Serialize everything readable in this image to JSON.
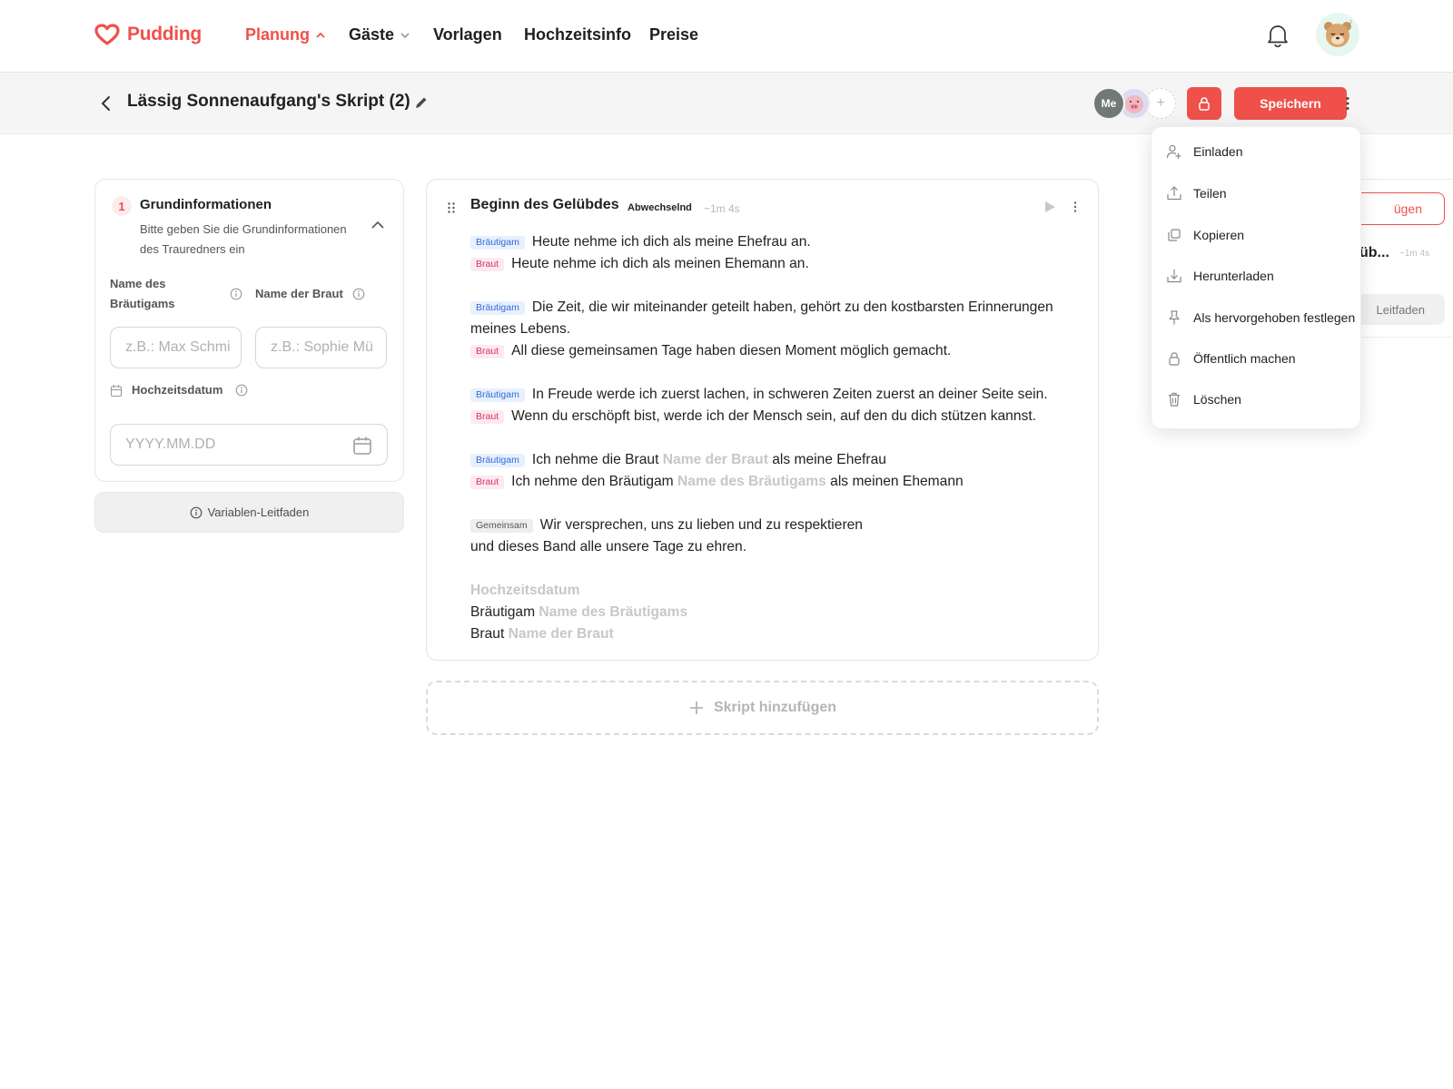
{
  "brand": {
    "name": "Pudding",
    "accent": "#f0504a"
  },
  "nav": {
    "items": [
      {
        "label": "Planung",
        "active": true,
        "chevron": "up"
      },
      {
        "label": "Gäste",
        "active": false,
        "chevron": "down"
      },
      {
        "label": "Vorlagen",
        "active": false
      },
      {
        "label": "Hochzeitsinfo",
        "active": false
      },
      {
        "label": "Preise",
        "active": false
      }
    ],
    "icons": [
      "bell-icon",
      "user-avatar-bear"
    ]
  },
  "header": {
    "title": "Lässig Sonnenaufgang's Skript (2)",
    "collaborators": [
      "Me"
    ],
    "save_label": "Speichern"
  },
  "basic_info": {
    "step": "1",
    "title": "Grundinformationen",
    "subtitle": "Bitte geben Sie die Grundinformationen des Trauredners ein",
    "groom_label": "Name des Bräutigams",
    "bride_label": "Name der Braut",
    "groom_placeholder": "z.B.: Max Schmi",
    "bride_placeholder": "z.B.: Sophie Mü",
    "date_label": "Hochzeitsdatum",
    "date_placeholder": "YYYY.MM.DD"
  },
  "variable_guide_label": "Variablen-Leitfaden",
  "script": {
    "title": "Beginn des Gelübdes",
    "mode": "Abwechselnd",
    "duration": "~1m 4s",
    "tags": {
      "groom": "Bräutigam",
      "bride": "Braut",
      "both": "Gemeinsam"
    },
    "vars": {
      "groom_name": "Name des Bräutigams",
      "bride_name": "Name der Braut",
      "date": "Hochzeitsdatum"
    },
    "lines": {
      "l1": "Heute nehme ich dich als meine Ehefrau an.",
      "l2": "Heute nehme ich dich als meinen Ehemann an.",
      "l3a": "Die Zeit, die wir miteinander geteilt haben, gehört zu den kostbarsten Erinnerungen",
      "l3b": "meines Lebens.",
      "l4": "All diese gemeinsamen Tage haben diesen Moment möglich gemacht.",
      "l5": "In Freude werde ich zuerst lachen, in schweren Zeiten zuerst an deiner Seite sein.",
      "l6": "Wenn du erschöpft bist, werde ich der Mensch sein, auf den du dich stützen kannst.",
      "l7_pre": "Ich nehme die Braut",
      "l7_post": "als meine Ehefrau",
      "l8_pre": "Ich nehme den Bräutigam",
      "l8_post": "als meinen Ehemann",
      "l9a": "Wir versprechen, uns zu lieben und zu respektieren",
      "l9b": "und dieses Band alle unsere Tage zu ehren.",
      "sig_groom": "Bräutigam",
      "sig_bride": "Braut"
    },
    "add_label": "Skript hinzufügen"
  },
  "ghost_panel": {
    "btn": "ügen",
    "title": "üb...",
    "dur": "~1m 4s",
    "guide": "Leitfaden"
  },
  "menu": {
    "items": [
      {
        "label": "Einladen",
        "icon": "user-plus-icon"
      },
      {
        "label": "Teilen",
        "icon": "share-icon"
      },
      {
        "label": "Kopieren",
        "icon": "copy-icon"
      },
      {
        "label": "Herunterladen",
        "icon": "download-icon"
      },
      {
        "label": "Als hervorgehoben festlegen",
        "icon": "pin-icon"
      },
      {
        "label": "Öffentlich machen",
        "icon": "lock-icon"
      },
      {
        "label": "Löschen",
        "icon": "trash-icon"
      }
    ]
  }
}
